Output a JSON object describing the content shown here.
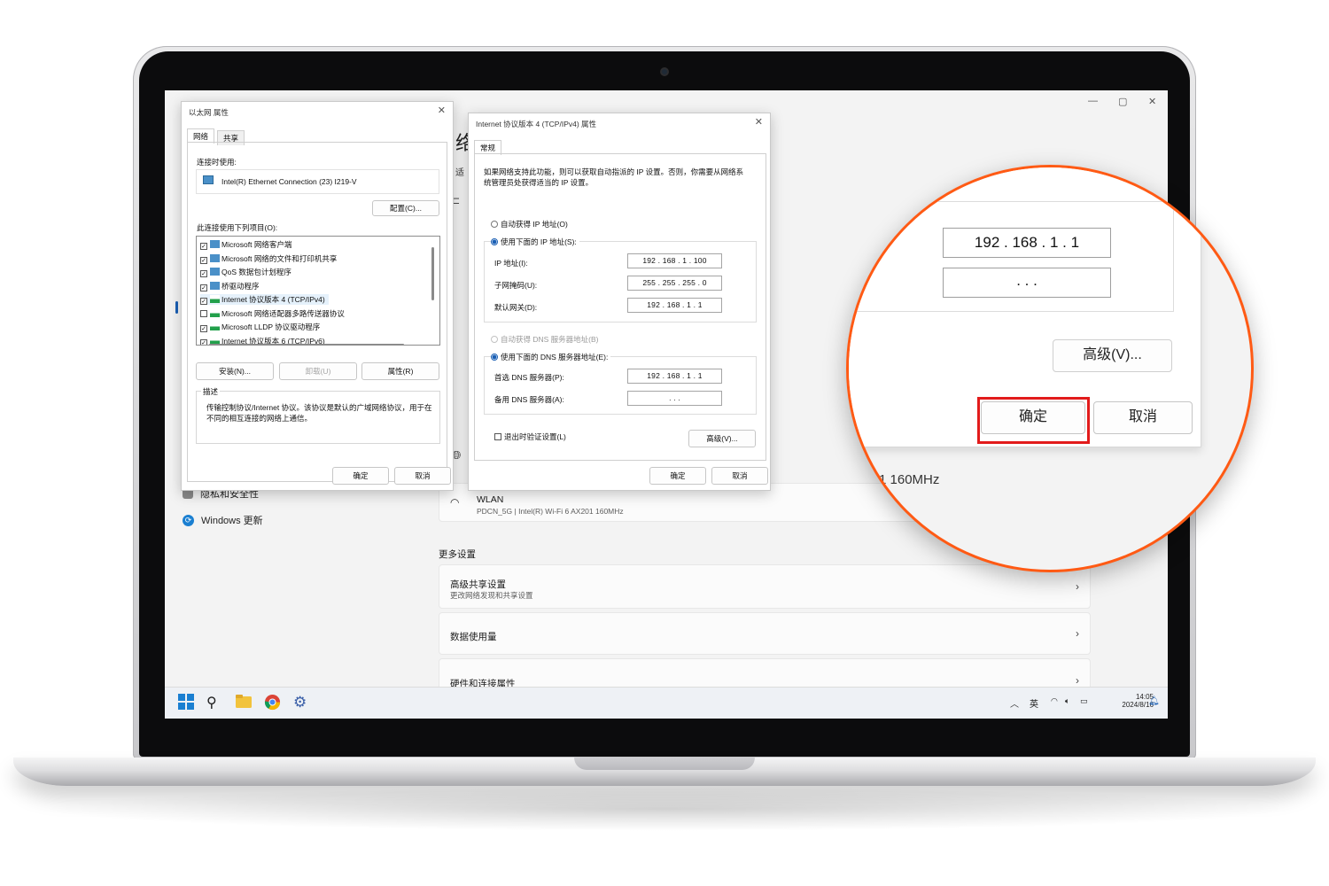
{
  "ethernet_dialog": {
    "title": "以太网 属性",
    "tabs": [
      "网络",
      "共享"
    ],
    "connect_using_label": "连接时使用:",
    "adapter_name": "Intel(R) Ethernet Connection (23) I219-V",
    "configure_button": "配置(C)...",
    "items_label": "此连接使用下列项目(O):",
    "components": [
      {
        "label": "Microsoft 网络客户端",
        "checked": true,
        "icon": "network-client-icon"
      },
      {
        "label": "Microsoft 网络的文件和打印机共享",
        "checked": true,
        "icon": "network-client-icon"
      },
      {
        "label": "QoS 数据包计划程序",
        "checked": true,
        "icon": "network-client-icon"
      },
      {
        "label": "桥驱动程序",
        "checked": true,
        "icon": "network-client-icon"
      },
      {
        "label": "Internet 协议版本 4 (TCP/IPv4)",
        "checked": true,
        "icon": "protocol-icon"
      },
      {
        "label": "Microsoft 网络适配器多路传送器协议",
        "checked": false,
        "icon": "protocol-icon"
      },
      {
        "label": "Microsoft LLDP 协议驱动程序",
        "checked": true,
        "icon": "protocol-icon"
      },
      {
        "label": "Internet 协议版本 6 (TCP/IPv6)",
        "checked": true,
        "icon": "protocol-icon"
      }
    ],
    "install_button": "安装(N)...",
    "uninstall_button": "卸载(U)",
    "properties_button": "属性(R)",
    "description_label": "描述",
    "description_text": "传输控制协议/Internet 协议。该协议是默认的广域网络协议，用于在不同的相互连接的网络上通信。",
    "ok_button": "确定",
    "cancel_button": "取消"
  },
  "ipv4_dialog": {
    "title": "Internet 协议版本 4 (TCP/IPv4) 属性",
    "tab": "常规",
    "intro": "如果网络支持此功能，则可以获取自动指派的 IP 设置。否则，你需要从网络系统管理员处获得适当的 IP 设置。",
    "auto_ip": "自动获得 IP 地址(O)",
    "manual_ip": "使用下面的 IP 地址(S):",
    "ip_label": "IP 地址(I):",
    "ip_value": "192 . 168 .  1  . 100",
    "mask_label": "子网掩码(U):",
    "mask_value": "255 . 255 . 255 .  0",
    "gateway_label": "默认网关(D):",
    "gateway_value": "192 . 168 .  1  .  1",
    "auto_dns": "自动获得 DNS 服务器地址(B)",
    "manual_dns": "使用下面的 DNS 服务器地址(E):",
    "dns1_label": "首选 DNS 服务器(P):",
    "dns1_value": "192 . 168 .  1  .  1",
    "dns2_label": "备用 DNS 服务器(A):",
    "dns2_value": "  .     .     .  ",
    "validate_label": "退出时验证设置(L)",
    "advanced_button": "高级(V)...",
    "ok_button": "确定",
    "cancel_button": "取消"
  },
  "settings": {
    "heading_fragment": "络",
    "subheading_fragment": "适",
    "sidebar": [
      {
        "label": "隐私和安全性"
      },
      {
        "label": "Windows 更新"
      }
    ],
    "wlan_title": "WLAN",
    "wlan_sub": "PDCN_5G | Intel(R) Wi-Fi 6 AX201 160MHz",
    "more_settings": "更多设置",
    "rows": [
      {
        "title": "高级共享设置",
        "sub": "更改网络发现和共享设置"
      },
      {
        "title": "数据使用量",
        "sub": ""
      },
      {
        "title": "硬件和连接属性",
        "sub": ""
      }
    ]
  },
  "taskbar": {
    "ime": "英",
    "time": "14:05",
    "date": "2024/8/16"
  },
  "zoom": {
    "gateway_value": "192 . 168 .  1  .  1",
    "dns2_value": "  .     .     .  ",
    "advanced_button": "高级(V)...",
    "ok_button": "确定",
    "cancel_button": "取消",
    "behind_text": "1 160MHz"
  },
  "colors": {
    "highlight_ring": "#ff5a14",
    "ok_highlight": "#e21b1b",
    "accent": "#1a5fb4"
  }
}
